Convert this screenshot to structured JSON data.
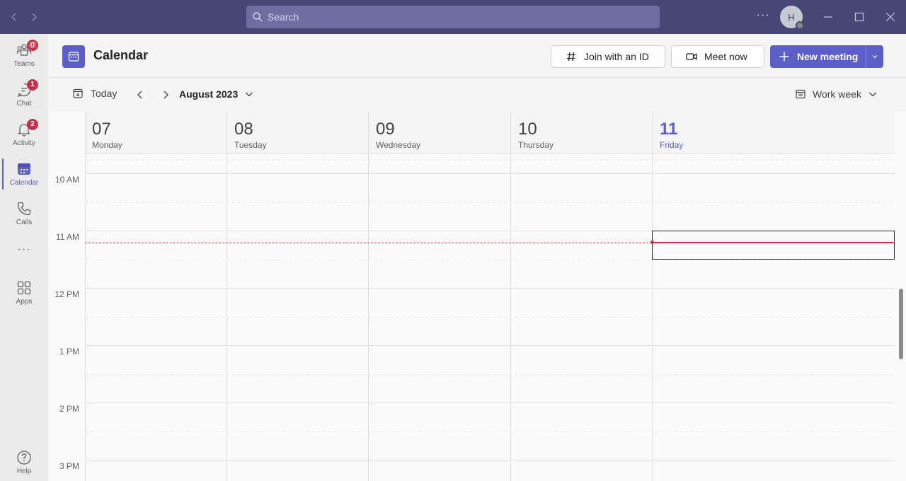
{
  "titlebar": {
    "search_placeholder": "Search",
    "avatar_initial": "H",
    "more_label": "···"
  },
  "rail": {
    "items": [
      {
        "label": "Teams",
        "badge": "@",
        "icon": "teams-icon"
      },
      {
        "label": "Chat",
        "badge": "1",
        "icon": "chat-icon"
      },
      {
        "label": "Activity",
        "badge": "2",
        "icon": "bell-icon"
      },
      {
        "label": "Calendar",
        "badge": "",
        "icon": "calendar-icon",
        "active": true
      },
      {
        "label": "Calls",
        "badge": "",
        "icon": "phone-icon"
      },
      {
        "label": "Apps",
        "badge": "",
        "icon": "apps-icon"
      },
      {
        "label": "Help",
        "badge": "",
        "icon": "help-icon"
      }
    ],
    "more_label": "···"
  },
  "header": {
    "title": "Calendar",
    "join_label": "Join with an ID",
    "meet_label": "Meet now",
    "new_meeting_label": "New meeting"
  },
  "toolbar": {
    "today_label": "Today",
    "month_label": "August 2023",
    "view_label": "Work week"
  },
  "days": [
    {
      "num": "07",
      "name": "Monday"
    },
    {
      "num": "08",
      "name": "Tuesday"
    },
    {
      "num": "09",
      "name": "Wednesday"
    },
    {
      "num": "10",
      "name": "Thursday"
    },
    {
      "num": "11",
      "name": "Friday",
      "today": true
    }
  ],
  "times": [
    "10 AM",
    "11 AM",
    "12 PM",
    "1 PM",
    "2 PM",
    "3 PM"
  ],
  "colors": {
    "titlebar": "#464775",
    "accent": "#5b5fc7",
    "now_line": "#c4314b",
    "badge": "#c4314b"
  }
}
